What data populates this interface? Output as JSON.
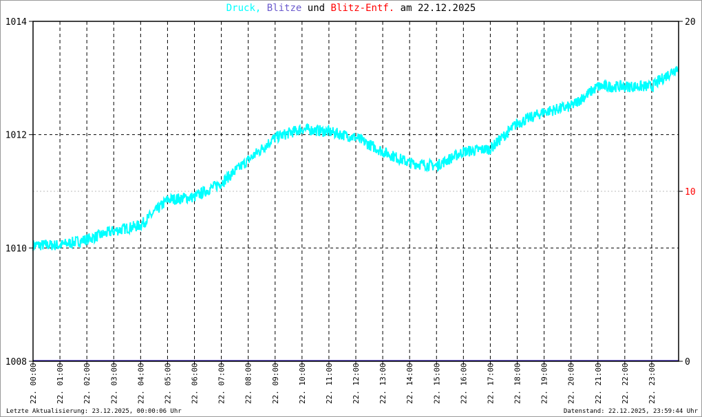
{
  "title": {
    "parts": [
      {
        "text": "Druck,",
        "color": "#00ffff"
      },
      {
        "text": "Blitze",
        "color": "#6a5acd"
      },
      {
        "text": "und",
        "color": "#000000"
      },
      {
        "text": "Blitz-Entf.",
        "color": "#ff0000"
      },
      {
        "text": "am 22.12.2025",
        "color": "#000000"
      }
    ]
  },
  "footer": {
    "last_update": "Letzte Aktualisierung: 23.12.2025, 00:00:06 Uhr",
    "data_status": "Datenstand: 22.12.2025, 23:59:44 Uhr"
  },
  "chart_data": {
    "type": "line",
    "title": "Druck, Blitze und Blitz-Entf. am 22.12.2025",
    "x_ticks": [
      "22. 00:00",
      "22. 01:00",
      "22. 02:00",
      "22. 03:00",
      "22. 04:00",
      "22. 05:00",
      "22. 06:00",
      "22. 07:00",
      "22. 08:00",
      "22. 09:00",
      "22. 10:00",
      "22. 11:00",
      "22. 12:00",
      "22. 13:00",
      "22. 14:00",
      "22. 15:00",
      "22. 16:00",
      "22. 17:00",
      "22. 18:00",
      "22. 19:00",
      "22. 20:00",
      "22. 21:00",
      "22. 22:00",
      "22. 23:00"
    ],
    "x_range_hours": [
      0,
      24
    ],
    "y_left": {
      "range": [
        1008,
        1014
      ],
      "ticks": [
        "1008",
        "1010",
        "1012",
        "1014"
      ]
    },
    "y_right": {
      "range": [
        0,
        20
      ],
      "ticks": [
        "0",
        "10",
        "20"
      ],
      "mid_color": "#ff0000"
    },
    "series": [
      {
        "name": "Druck",
        "color": "#00ffff",
        "noise_hpa": 0.1,
        "hourly_values": [
          1010.05,
          1010.05,
          1010.15,
          1010.3,
          1010.4,
          1010.85,
          1010.9,
          1011.15,
          1011.55,
          1011.95,
          1012.1,
          1012.05,
          1011.95,
          1011.7,
          1011.5,
          1011.45,
          1011.7,
          1011.75,
          1012.2,
          1012.4,
          1012.5,
          1012.85,
          1012.85,
          1012.85,
          1013.2
        ]
      },
      {
        "name": "Blitze",
        "color": "#6a5acd",
        "values": [
          0
        ]
      },
      {
        "name": "Blitz-Entf.",
        "color": "#ff0000",
        "values": []
      }
    ],
    "grid": true
  }
}
